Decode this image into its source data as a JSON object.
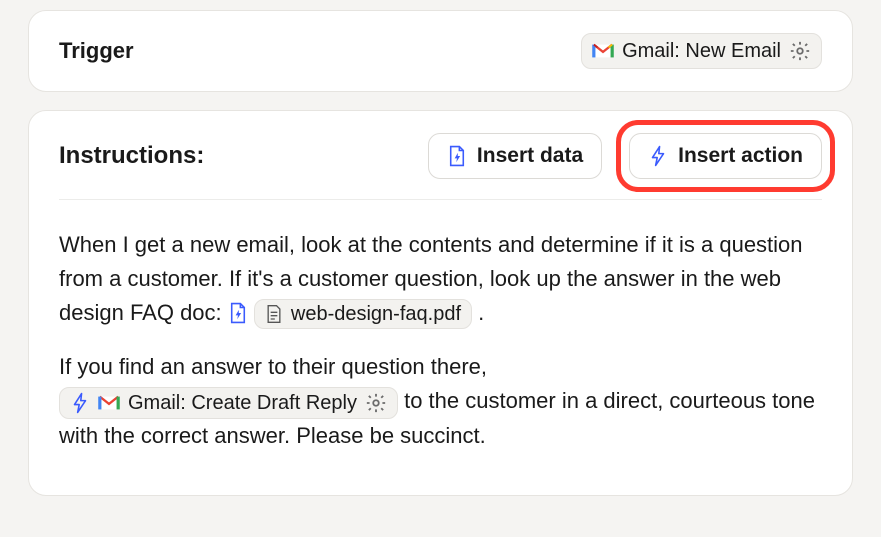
{
  "trigger": {
    "label": "Trigger",
    "chip_text": "Gmail: New Email"
  },
  "instructions": {
    "label": "Instructions:",
    "insert_data_label": "Insert data",
    "insert_action_label": "Insert action",
    "body": {
      "p1_a": "When I get a new email, look at the contents and determine if it is a question from a customer. If it's a customer question, look up the answer in the web design FAQ doc: ",
      "faq_chip": "web-design-faq.pdf",
      "p1_b": " .",
      "p2_a": "If you find an answer to their question there, ",
      "action_chip": "Gmail: Create Draft Reply",
      "p2_b": " to the customer in a direct, courteous tone with the correct answer. Please be succinct."
    }
  }
}
